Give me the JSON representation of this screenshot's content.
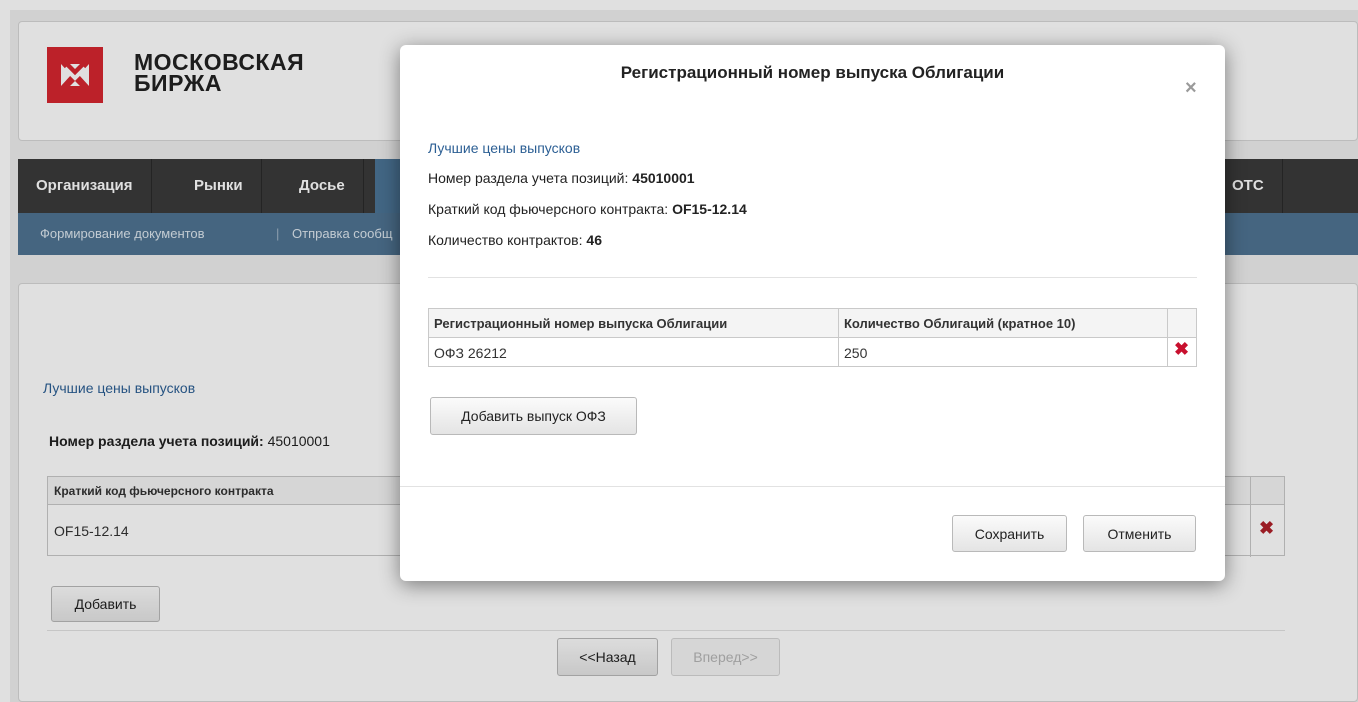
{
  "header": {
    "logo_line1": "МОСКОВСКАЯ",
    "logo_line2": "БИРЖА"
  },
  "nav": {
    "items": [
      "Организация",
      "Рынки",
      "Досье"
    ],
    "right_item": "ОТС"
  },
  "subnav": {
    "items": [
      "Формирование документов",
      "Отправка сообщ"
    ]
  },
  "background": {
    "link": "Лучшие цены выпусков",
    "section_label": "Номер раздела учета позиций:",
    "section_value": "45010001",
    "table": {
      "headers": [
        "Краткий код фьючерсного контракта"
      ],
      "rows": [
        [
          "OF15-12.14"
        ]
      ]
    },
    "add_button": "Добавить",
    "back_button": "<<Назад",
    "forward_button": "Вперед>>"
  },
  "modal": {
    "title": "Регистрационный номер выпуска Облигации",
    "close_glyph": "×",
    "link": "Лучшие цены выпусков",
    "section_label": "Номер раздела учета позиций:",
    "section_value": "45010001",
    "contract_label": "Краткий код фьючерсного контракта:",
    "contract_value": "OF15-12.14",
    "quantity_label": "Количество контрактов:",
    "quantity_value": "46",
    "table": {
      "headers": [
        "Регистрационный номер выпуска Облигации",
        "Количество Облигаций (кратное 10)"
      ],
      "rows": [
        [
          "ОФЗ 26212",
          "250"
        ]
      ]
    },
    "add_button": "Добавить выпуск ОФЗ",
    "save_button": "Сохранить",
    "cancel_button": "Отменить",
    "delete_glyph": "✖"
  },
  "colors": {
    "accent": "#d6262f",
    "nav_bg": "#3b3b3b",
    "subnav_bg": "#4f7392",
    "link": "#2c5f94",
    "delete": "#c8102e"
  }
}
